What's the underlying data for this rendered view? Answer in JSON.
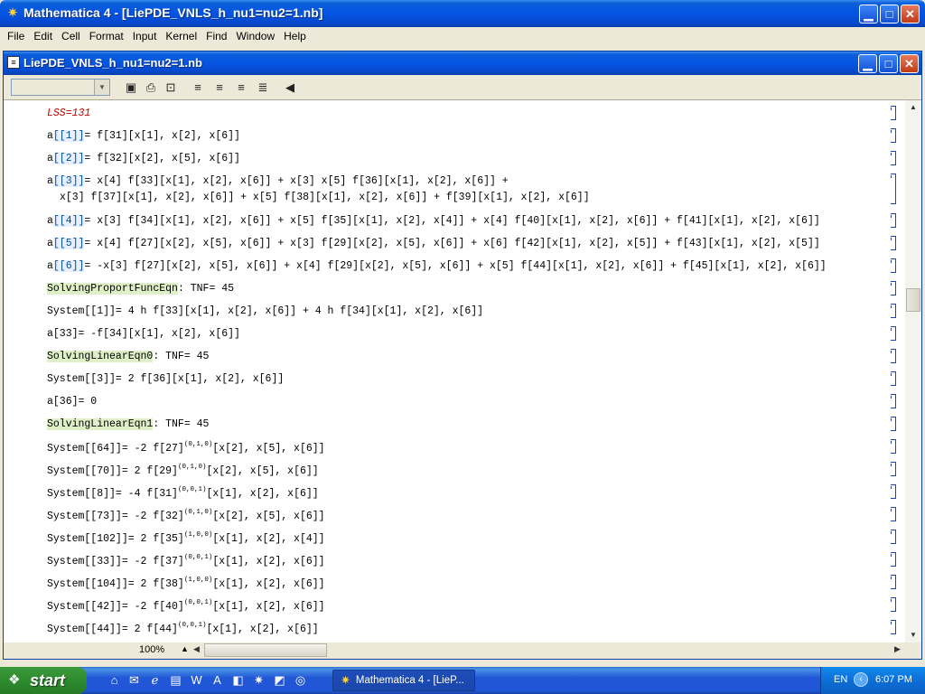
{
  "app": {
    "title": "Mathematica 4 - [LiePDE_VNLS_h_nu1=nu2=1.nb]",
    "notebook_title": "LiePDE_VNLS_h_nu1=nu2=1.nb"
  },
  "menu": [
    "File",
    "Edit",
    "Cell",
    "Format",
    "Input",
    "Kernel",
    "Find",
    "Window",
    "Help"
  ],
  "toolbar": {
    "style_value": "",
    "icons": [
      "save-icon",
      "print-icon",
      "print-preview-icon",
      "align-left-icon",
      "align-center-icon",
      "align-right-icon",
      "align-justify-icon",
      "collapse-left-icon"
    ]
  },
  "cells": [
    {
      "text": "LSS=131",
      "kind": "lss"
    },
    {
      "prefix": "a",
      "idx": "[[1]]",
      "rest": "= f[31][x[1], x[2], x[6]]"
    },
    {
      "prefix": "a",
      "idx": "[[2]]",
      "rest": "= f[32][x[2], x[5], x[6]]"
    },
    {
      "prefix": "a",
      "idx": "[[3]]",
      "rest": "= x[4] f[33][x[1], x[2], x[6]] + x[3] x[5] f[36][x[1], x[2], x[6]] +",
      "line2": "x[3] f[37][x[1], x[2], x[6]] + x[5] f[38][x[1], x[2], x[6]] + f[39][x[1], x[2], x[6]]"
    },
    {
      "prefix": "a",
      "idx": "[[4]]",
      "rest": "= x[3] f[34][x[1], x[2], x[6]] + x[5] f[35][x[1], x[2], x[4]] + x[4] f[40][x[1], x[2], x[6]] + f[41][x[1], x[2], x[6]]"
    },
    {
      "prefix": "a",
      "idx": "[[5]]",
      "rest": "= x[4] f[27][x[2], x[5], x[6]] + x[3] f[29][x[2], x[5], x[6]] + x[6] f[42][x[1], x[2], x[5]] + f[43][x[1], x[2], x[5]]"
    },
    {
      "prefix": "a",
      "idx": "[[6]]",
      "rest": "= -x[3] f[27][x[2], x[5], x[6]] + x[4] f[29][x[2], x[5], x[6]] + x[5] f[44][x[1], x[2], x[6]] + f[45][x[1], x[2], x[6]]"
    },
    {
      "hl": "SolvingProportFuncEqn",
      "rest": ": TNF= 45"
    },
    {
      "text": "System[[1]]= 4 h f[33][x[1], x[2], x[6]] + 4 h f[34][x[1], x[2], x[6]]"
    },
    {
      "text": "a[33]= -f[34][x[1], x[2], x[6]]"
    },
    {
      "hl": "SolvingLinearEqn0",
      "rest": ": TNF= 45"
    },
    {
      "text": "System[[3]]= 2 f[36][x[1], x[2], x[6]]"
    },
    {
      "text": "a[36]= 0"
    },
    {
      "hl": "SolvingLinearEqn1",
      "rest": ": TNF= 45"
    },
    {
      "pre": "System[[64]]= -2 f[27]",
      "sup": "(0,1,0)",
      "post": "[x[2], x[5], x[6]]"
    },
    {
      "pre": "System[[70]]= 2 f[29]",
      "sup": "(0,1,0)",
      "post": "[x[2], x[5], x[6]]"
    },
    {
      "pre": "System[[8]]= -4 f[31]",
      "sup": "(0,0,1)",
      "post": "[x[1], x[2], x[6]]"
    },
    {
      "pre": "System[[73]]= -2 f[32]",
      "sup": "(0,1,0)",
      "post": "[x[2], x[5], x[6]]"
    },
    {
      "pre": "System[[102]]= 2 f[35]",
      "sup": "(1,0,0)",
      "post": "[x[1], x[2], x[4]]"
    },
    {
      "pre": "System[[33]]= -2 f[37]",
      "sup": "(0,0,1)",
      "post": "[x[1], x[2], x[6]]"
    },
    {
      "pre": "System[[104]]= 2 f[38]",
      "sup": "(1,0,0)",
      "post": "[x[1], x[2], x[6]]"
    },
    {
      "pre": "System[[42]]= -2 f[40]",
      "sup": "(0,0,1)",
      "post": "[x[1], x[2], x[6]]"
    },
    {
      "pre": "System[[44]]= 2 f[44]",
      "sup": "(0,0,1)",
      "post": "[x[1], x[2], x[6]]"
    }
  ],
  "status": {
    "zoom": "100%"
  },
  "taskbar": {
    "start_label": "start",
    "task_label": "Mathematica 4 - [LieP...",
    "lang": "EN",
    "clock": "6:07 PM"
  }
}
